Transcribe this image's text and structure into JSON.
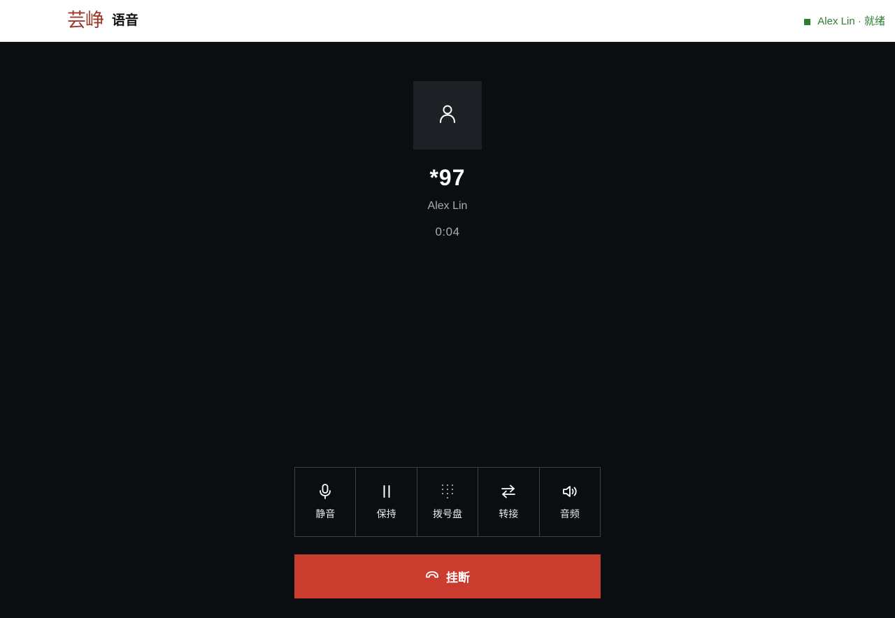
{
  "header": {
    "logo_text": "芸峥",
    "app_name": "语音",
    "status_text": "Alex Lin · 就绪",
    "status_color": "#2e7d32"
  },
  "call": {
    "avatar_icon": "user-icon",
    "number": "*97",
    "name": "Alex Lin",
    "duration": "0:04"
  },
  "controls": [
    {
      "label": "静音",
      "icon": "microphone-icon"
    },
    {
      "label": "保持",
      "icon": "pause-icon"
    },
    {
      "label": "拨号盘",
      "icon": "dialpad-icon"
    },
    {
      "label": "转接",
      "icon": "transfer-icon"
    },
    {
      "label": "音频",
      "icon": "speaker-icon"
    }
  ],
  "hangup": {
    "label": "挂断",
    "icon": "hangup-phone-icon",
    "color": "#c93c2e"
  }
}
